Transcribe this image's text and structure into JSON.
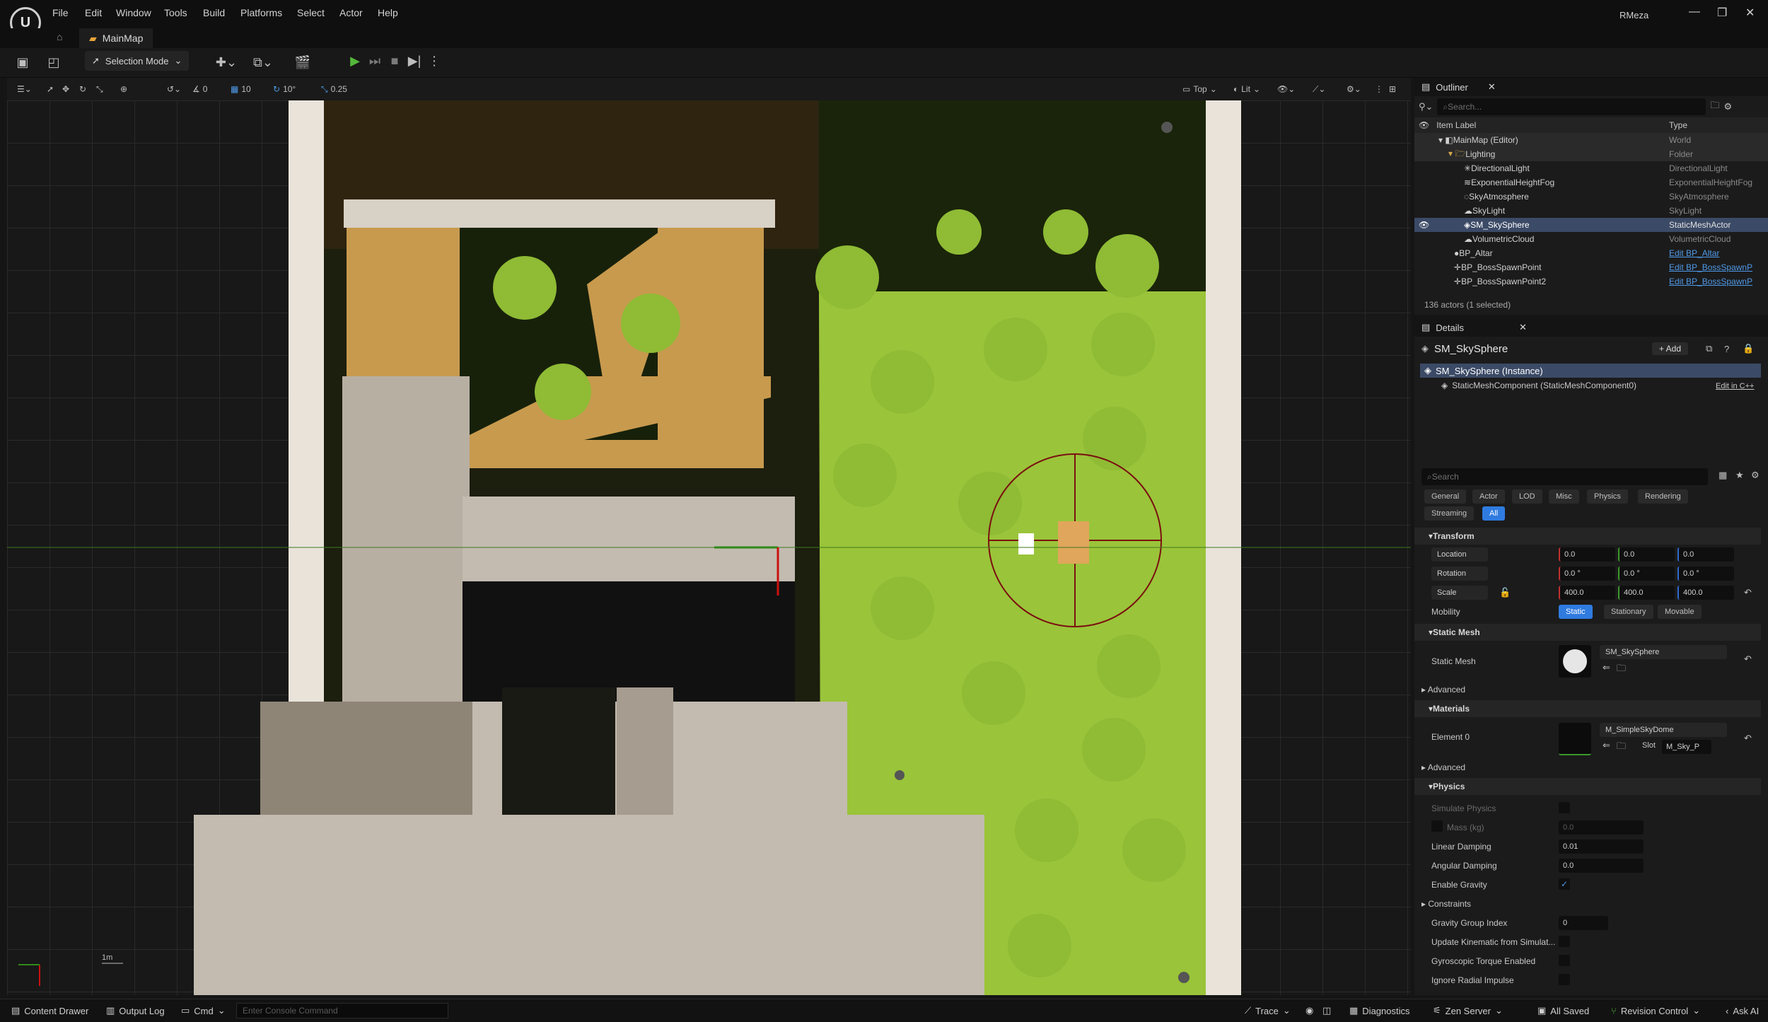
{
  "app": {
    "menu": [
      "File",
      "Edit",
      "Window",
      "Tools",
      "Build",
      "Platforms",
      "Select",
      "Actor",
      "Help"
    ],
    "map_tab": "MainMap",
    "user": "RMeza"
  },
  "toolbar": {
    "selection_mode": "Selection Mode"
  },
  "viewport_toolbar": {
    "translate_snap": "10",
    "rotate_snap": "10°",
    "scale_snap": "0.25",
    "angle_value": "0",
    "view_mode": "Top",
    "lit_mode": "Lit",
    "scale_label": "1m"
  },
  "outliner": {
    "title": "Outliner",
    "search_placeholder": "Search...",
    "col_label": "Item Label",
    "col_type": "Type",
    "rows": [
      {
        "label": "MainMap (Editor)",
        "type": "World"
      },
      {
        "label": "Lighting",
        "type": "Folder"
      },
      {
        "label": "DirectionalLight",
        "type": "DirectionalLight"
      },
      {
        "label": "ExponentialHeightFog",
        "type": "ExponentialHeightFog"
      },
      {
        "label": "SkyAtmosphere",
        "type": "SkyAtmosphere"
      },
      {
        "label": "SkyLight",
        "type": "SkyLight"
      },
      {
        "label": "SM_SkySphere",
        "type": "StaticMeshActor"
      },
      {
        "label": "VolumetricCloud",
        "type": "VolumetricCloud"
      },
      {
        "label": "BP_Altar",
        "type": "Edit BP_Altar"
      },
      {
        "label": "BP_BossSpawnPoint",
        "type": "Edit BP_BossSpawnP"
      },
      {
        "label": "BP_BossSpawnPoint2",
        "type": "Edit BP_BossSpawnP"
      }
    ],
    "footer": "136 actors (1 selected)"
  },
  "details": {
    "title": "Details",
    "actor_name": "SM_SkySphere",
    "add_label": "+ Add",
    "instance": "SM_SkySphere (Instance)",
    "component": "StaticMeshComponent (StaticMeshComponent0)",
    "edit_cpp": "Edit in C++",
    "search_placeholder": "Search",
    "filters": [
      "General",
      "Actor",
      "LOD",
      "Misc",
      "Physics",
      "Rendering",
      "Streaming",
      "All"
    ],
    "transform": {
      "title": "Transform",
      "location_label": "Location",
      "rotation_label": "Rotation",
      "scale_label": "Scale",
      "location": [
        "0.0",
        "0.0",
        "0.0"
      ],
      "rotation": [
        "0.0 °",
        "0.0 °",
        "0.0 °"
      ],
      "scale": [
        "400.0",
        "400.0",
        "400.0"
      ],
      "mobility_label": "Mobility",
      "mobility_options": [
        "Static",
        "Stationary",
        "Movable"
      ]
    },
    "static_mesh": {
      "title": "Static Mesh",
      "label": "Static Mesh",
      "value": "SM_SkySphere",
      "advanced": "Advanced"
    },
    "materials": {
      "title": "Materials",
      "element_label": "Element 0",
      "value": "M_SimpleSkyDome",
      "slot_label": "Slot",
      "slot_value": "M_Sky_P",
      "advanced": "Advanced"
    },
    "physics": {
      "title": "Physics",
      "simulate": "Simulate Physics",
      "mass": "Mass (kg)",
      "mass_value": "0.0",
      "linear_damping": "Linear Damping",
      "linear_damping_value": "0.01",
      "angular_damping": "Angular Damping",
      "angular_damping_value": "0.0",
      "enable_gravity": "Enable Gravity",
      "constraints": "Constraints",
      "gravity_group": "Gravity Group Index",
      "gravity_group_value": "0",
      "update_kinematic": "Update Kinematic from Simulat...",
      "gyroscopic": "Gyroscopic Torque Enabled",
      "ignore_radial": "Ignore Radial Impulse"
    }
  },
  "statusbar": {
    "content_drawer": "Content Drawer",
    "output_log": "Output Log",
    "cmd": "Cmd",
    "console_placeholder": "Enter Console Command",
    "trace": "Trace",
    "diagnostics": "Diagnostics",
    "zen_server": "Zen Server",
    "all_saved": "All Saved",
    "revision_control": "Revision Control",
    "ask_ai": "Ask AI"
  }
}
